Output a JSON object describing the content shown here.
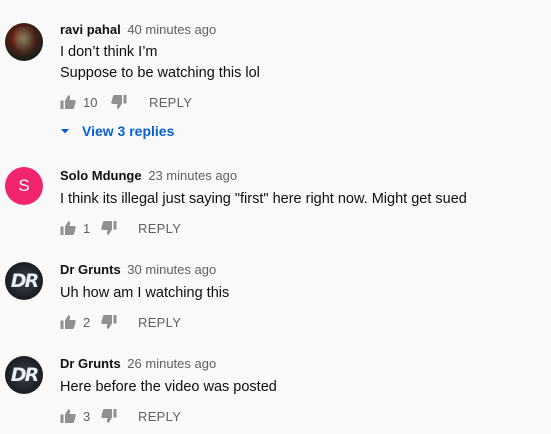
{
  "comments": [
    {
      "author": "ravi pahal",
      "time": "40 minutes ago",
      "lines": [
        "I don’t think I’m",
        "Suppose to be watching this lol"
      ],
      "likes": "10",
      "reply_label": "REPLY",
      "avatar_letter": ""
    },
    {
      "author": "Solo Mdunge",
      "time": "23 minutes ago",
      "lines": [
        "I think its illegal just saying \"first\" here right now. Might get sued"
      ],
      "likes": "1",
      "reply_label": "REPLY",
      "avatar_letter": "S"
    },
    {
      "author": "Dr Grunts",
      "time": "30 minutes ago",
      "lines": [
        "Uh how am I watching this"
      ],
      "likes": "2",
      "reply_label": "REPLY",
      "avatar_letter": "DR"
    },
    {
      "author": "Dr Grunts",
      "time": "26 minutes ago",
      "lines": [
        "Here before the video was posted"
      ],
      "likes": "3",
      "reply_label": "REPLY",
      "avatar_letter": "DR"
    }
  ],
  "view_replies_label": "View 3 replies",
  "colors": {
    "link_blue": "#065fd4",
    "icon_gray": "#909090",
    "avatar_s_pink": "#f1246e"
  }
}
